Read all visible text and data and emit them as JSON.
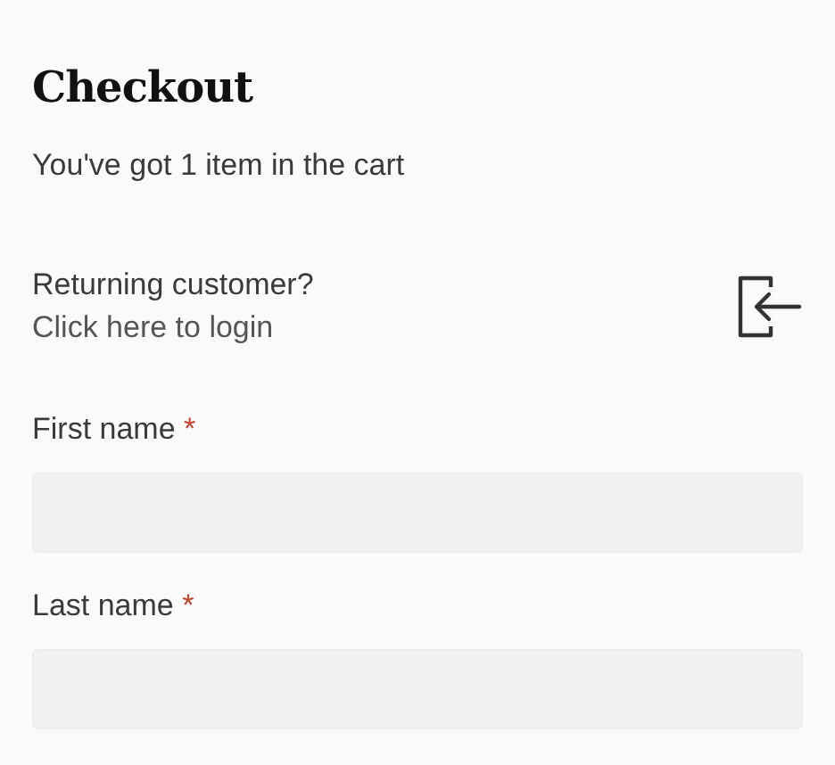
{
  "title": "Checkout",
  "subtitle": "You've got 1 item in the cart",
  "login": {
    "question": "Returning customer?",
    "link": "Click here to login"
  },
  "fields": [
    {
      "label": "First name",
      "marker": "*"
    },
    {
      "label": "Last name",
      "marker": "*"
    }
  ]
}
